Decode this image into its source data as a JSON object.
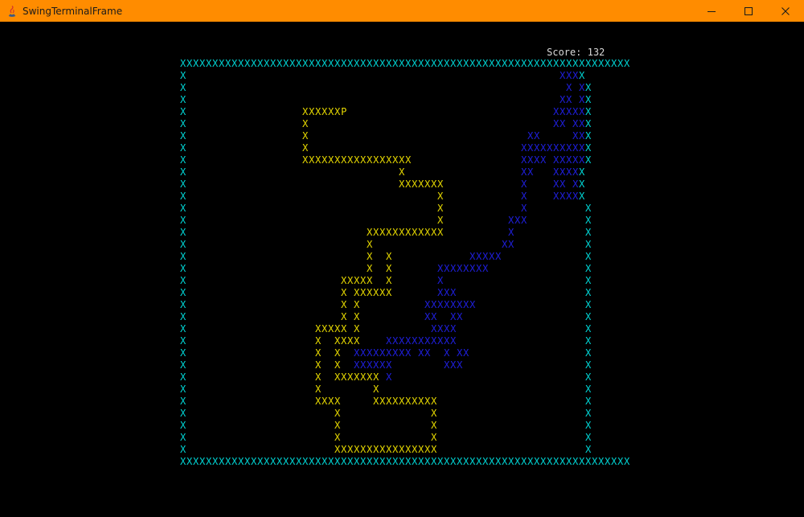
{
  "window": {
    "title": "SwingTerminalFrame",
    "app_icon": "java-icon",
    "controls": [
      "minimize-icon",
      "maximize-icon",
      "close-icon"
    ]
  },
  "score": {
    "label": "Score:",
    "value": "132"
  },
  "colors": {
    "titlebar": "#ff8c00",
    "background": "#000000",
    "wall": "#00d4d4",
    "player": "#e6d800",
    "enemy": "#1f1fdd",
    "score_text": "#d9d9d9"
  },
  "legend": {
    "C": "wall",
    "Y": "player",
    "B": "enemy"
  },
  "board": [
    "CCCCCCCCCCCCCCCCCCCCCCCCCCCCCCCCCCCCCCCCCCCCCCCCCCCCCCCCCCCCCCCCCCCCCC",
    "C                                                          BBBC",
    "C                                                           B BC",
    "C                                                          BB BC",
    "C                  YYYYYYP                                BBBBBC",
    "C                  Y                                      BB BBC",
    "C                  Y                                  BB     BBC",
    "C                  Y                                 BBBBBBBBBBC",
    "C                  YYYYYYYYYYYYYYYYY                 BBBB BBBBBC",
    "C                                 Y                  BB   BBBBC",
    "C                                 YYYYYYY            B    BB BC",
    "C                                       Y            B    BBBBC",
    "C                                       Y            B         C",
    "C                                       Y          BBB         C",
    "C                            YYYYYYYYYYYY          B           C",
    "C                            Y                    BB           C",
    "C                            Y  Y            BBBBB             C",
    "C                            Y  Y       BBBBBBBB               C",
    "C                        YYYYY  Y       B                      C",
    "C                        Y YYYYYY       BBB                    C",
    "C                        Y Y          BBBBBBBB                 C",
    "C                        Y Y          BB  BB                   C",
    "C                    YYYYY Y           BBBB                    C",
    "C                    Y  YYYY    BBBBBBBBBBB                    C",
    "C                    Y  Y  BBBBBBBBB BB  B BB                  C",
    "C                    Y  Y  BBBBBB        BBB                   C",
    "C                    Y  YYYYYYY B                              C",
    "C                    Y        Y                                C",
    "C                    YYYY     YYYYYYYYYY                       C",
    "C                       Y              Y                       C",
    "C                       Y              Y                       C",
    "C                       Y              Y                       C",
    "C                       YYYYYYYYYYYYYYYY                       C",
    "CCCCCCCCCCCCCCCCCCCCCCCCCCCCCCCCCCCCCCCCCCCCCCCCCCCCCCCCCCCCCCCCCCCCCC"
  ]
}
